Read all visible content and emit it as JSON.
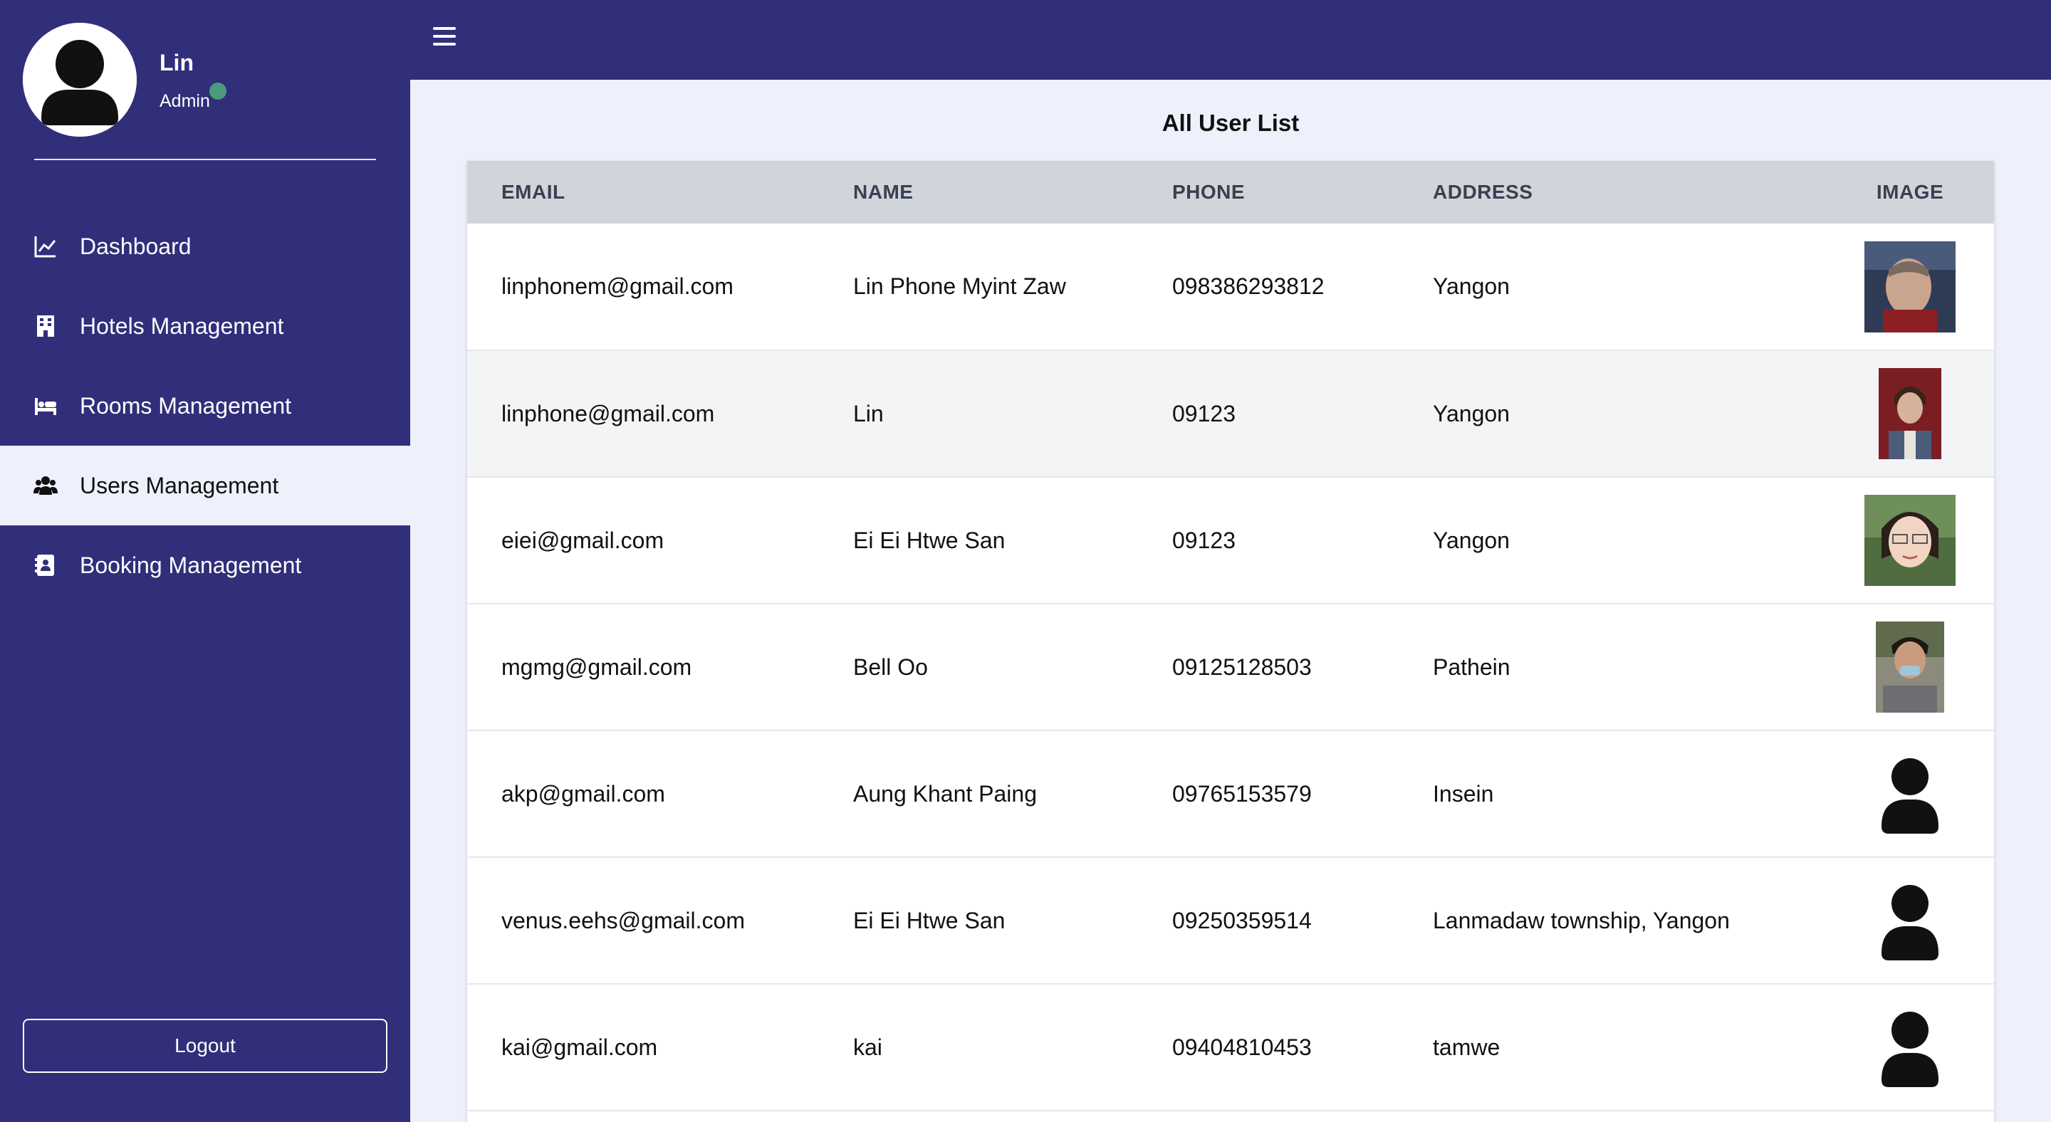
{
  "profile": {
    "name": "Lin",
    "role": "Admin",
    "status_color": "#4d9a7a"
  },
  "sidebar": {
    "items": [
      {
        "label": "Dashboard",
        "icon": "chart-line-icon",
        "active": false
      },
      {
        "label": "Hotels Management",
        "icon": "building-icon",
        "active": false
      },
      {
        "label": "Rooms Management",
        "icon": "bed-icon",
        "active": false
      },
      {
        "label": "Users Management",
        "icon": "users-icon",
        "active": true
      },
      {
        "label": "Booking Management",
        "icon": "address-book-icon",
        "active": false
      }
    ],
    "logout_label": "Logout"
  },
  "topbar": {
    "menu_icon": "hamburger-icon"
  },
  "main": {
    "title": "All User List",
    "table": {
      "columns": [
        "EMAIL",
        "NAME",
        "PHONE",
        "ADDRESS",
        "IMAGE"
      ],
      "rows": [
        {
          "email": "linphonem@gmail.com",
          "name": "Lin Phone Myint Zaw",
          "phone": "098386293812",
          "address": "Yangon",
          "image": "user-photo"
        },
        {
          "email": "linphone@gmail.com",
          "name": "Lin",
          "phone": "09123",
          "address": "Yangon",
          "image": "user-photo"
        },
        {
          "email": "eiei@gmail.com",
          "name": "Ei Ei Htwe San",
          "phone": "09123",
          "address": "Yangon",
          "image": "user-photo"
        },
        {
          "email": "mgmg@gmail.com",
          "name": "Bell Oo",
          "phone": "09125128503",
          "address": "Pathein",
          "image": "user-photo"
        },
        {
          "email": "akp@gmail.com",
          "name": "Aung Khant Paing",
          "phone": "09765153579",
          "address": "Insein",
          "image": "default-avatar"
        },
        {
          "email": "venus.eehs@gmail.com",
          "name": "Ei Ei Htwe San",
          "phone": "09250359514",
          "address": "Lanmadaw township, Yangon",
          "image": "default-avatar"
        },
        {
          "email": "kai@gmail.com",
          "name": "kai",
          "phone": "09404810453",
          "address": "tamwe",
          "image": "default-avatar"
        }
      ]
    }
  },
  "colors": {
    "sidebar_bg": "#312e7a",
    "page_bg": "#eef0fb",
    "header_row_bg": "#d1d5db"
  }
}
